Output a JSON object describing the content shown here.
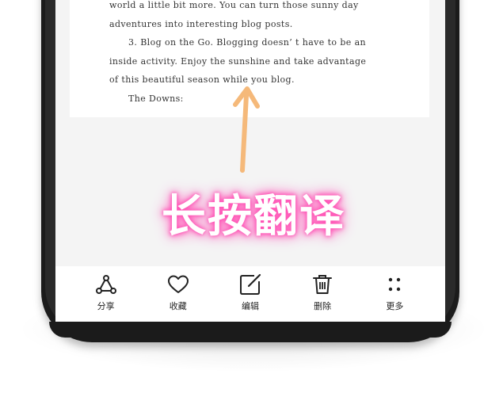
{
  "document": {
    "lines": [
      "world a little bit more. You can turn those sunny day",
      "adventures into interesting blog posts.",
      "3. Blog on the Go. Blogging doesn’ t have to be an",
      "inside activity. Enjoy the sunshine and take advantage",
      "of this beautiful season while you blog.",
      "The Downs:"
    ]
  },
  "overlay": {
    "title": "长按翻译"
  },
  "toolbar": {
    "share_label": "分享",
    "favorite_label": "收藏",
    "edit_label": "编辑",
    "delete_label": "删除",
    "more_label": "更多"
  },
  "icons": {
    "share": "share-icon",
    "favorite": "heart-icon",
    "edit": "edit-icon",
    "delete": "trash-icon",
    "more": "more-dots-icon"
  },
  "colors": {
    "arrow": "#f5b97a",
    "overlay_glow": "#ff4fb3",
    "screen_bg": "#f4f4f4",
    "frame": "#1b1b1b"
  }
}
